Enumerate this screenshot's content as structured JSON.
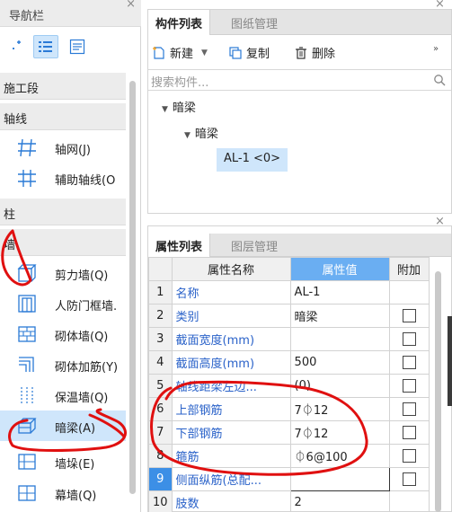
{
  "colors": {
    "accent": "#3c8fe6",
    "highlight": "#cfe6fb",
    "header_blue": "#6aaef2",
    "annotation": "#e01010",
    "link_text": "#2a62c9"
  },
  "nav": {
    "title": "导航栏",
    "categories": {
      "construction": "施工段",
      "axis": "轴线",
      "column": "柱",
      "wall": "墙"
    },
    "axis_items": [
      {
        "label": "轴网(J)",
        "icon": "axis-grid-icon"
      },
      {
        "label": "辅助轴线(O",
        "icon": "aux-axis-icon"
      }
    ],
    "wall_items": [
      {
        "label": "剪力墙(Q)",
        "icon": "shear-wall-icon"
      },
      {
        "label": "人防门框墙.",
        "icon": "civil-defense-door-wall-icon"
      },
      {
        "label": "砌体墙(Q)",
        "icon": "masonry-wall-icon"
      },
      {
        "label": "砌体加筋(Y)",
        "icon": "masonry-reinforcement-icon"
      },
      {
        "label": "保温墙(Q)",
        "icon": "insulation-wall-icon"
      },
      {
        "label": "暗梁(A)",
        "icon": "hidden-beam-icon"
      },
      {
        "label": "墙垛(E)",
        "icon": "wall-pier-icon"
      },
      {
        "label": "幕墙(Q)",
        "icon": "curtain-wall-icon"
      }
    ],
    "selected_item": "暗梁(A)"
  },
  "component_panel": {
    "tabs": [
      {
        "label": "构件列表",
        "active": true
      },
      {
        "label": "图纸管理",
        "active": false
      }
    ],
    "toolbar": {
      "new_label": "新建",
      "copy_label": "复制",
      "delete_label": "删除"
    },
    "search_placeholder": "搜索构件...",
    "tree": {
      "root": "暗梁",
      "child": "暗梁",
      "leaf": "AL-1 <0>"
    }
  },
  "property_panel": {
    "tabs": [
      {
        "label": "属性列表",
        "active": true
      },
      {
        "label": "图层管理",
        "active": false
      }
    ],
    "headers": {
      "name": "属性名称",
      "value": "属性值",
      "extra": "附加"
    },
    "rows": [
      {
        "no": "1",
        "name": "名称",
        "value": "AL-1",
        "checkbox": false
      },
      {
        "no": "2",
        "name": "类别",
        "value": "暗梁",
        "checkbox": true
      },
      {
        "no": "3",
        "name": "截面宽度(mm)",
        "value": "",
        "checkbox": true
      },
      {
        "no": "4",
        "name": "截面高度(mm)",
        "value": "500",
        "checkbox": true
      },
      {
        "no": "5",
        "name": "轴线距梁左边...",
        "value": "(0)",
        "checkbox": true
      },
      {
        "no": "6",
        "name": "上部钢筋",
        "value": "7⏀12",
        "checkbox": true
      },
      {
        "no": "7",
        "name": "下部钢筋",
        "value": "7⏀12",
        "checkbox": true
      },
      {
        "no": "8",
        "name": "箍筋",
        "value": "⏀6@100",
        "checkbox": true
      },
      {
        "no": "9",
        "name": "侧面纵筋(总配...",
        "value": "",
        "checkbox": true
      },
      {
        "no": "10",
        "name": "肢数",
        "value": "2",
        "checkbox": false
      }
    ]
  }
}
